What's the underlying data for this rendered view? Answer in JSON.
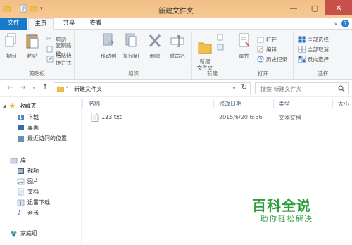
{
  "window": {
    "title": "新建文件夹",
    "controls": {
      "minimize": "—",
      "maximize": "▢",
      "close": "✕"
    }
  },
  "ribbon_tabs": [
    {
      "label": "文件"
    },
    {
      "label": "主页"
    },
    {
      "label": "共享"
    },
    {
      "label": "查看"
    }
  ],
  "ribbon": {
    "clipboard": {
      "group_label": "剪贴板",
      "copy": "复制",
      "paste": "粘贴",
      "cut": "剪切",
      "copy_path": "复制路径",
      "paste_shortcut": "粘贴快捷方式"
    },
    "organize": {
      "group_label": "组织",
      "move_to": "移动到",
      "copy_to": "复制到",
      "delete": "删除",
      "rename": "重命名"
    },
    "new": {
      "group_label": "新建",
      "new_folder": "新建\n文件夹"
    },
    "open": {
      "group_label": "打开",
      "properties": "属性",
      "open": "打开",
      "edit": "编辑",
      "history": "历史记录"
    },
    "select": {
      "group_label": "选择",
      "select_all": "全部选择",
      "select_none": "全部取消",
      "invert": "反向选择"
    }
  },
  "address": {
    "path": "新建文件夹",
    "search_placeholder": "搜索 新建文件夹"
  },
  "nav_pane": {
    "favorites": "收藏夹",
    "fav_items": [
      "下载",
      "桌面",
      "最近访问的位置"
    ],
    "libraries": "库",
    "lib_items": [
      "视频",
      "图片",
      "文档",
      "迅雷下载",
      "音乐"
    ],
    "homegroup": "家庭组"
  },
  "columns": {
    "name": "名称",
    "modified": "修改日期",
    "type": "类型",
    "size": "大小"
  },
  "files": [
    {
      "name": "123.txt",
      "modified": "2015/6/20 6:56",
      "type": "文本文档"
    }
  ],
  "watermark": {
    "title": "百科全说",
    "subtitle": "助你轻松解决"
  },
  "colors": {
    "titlebar": "#f2bf86",
    "file_tab": "#1979ca",
    "close_button": "#c7504b",
    "watermark_green": "#2e9e3c"
  }
}
